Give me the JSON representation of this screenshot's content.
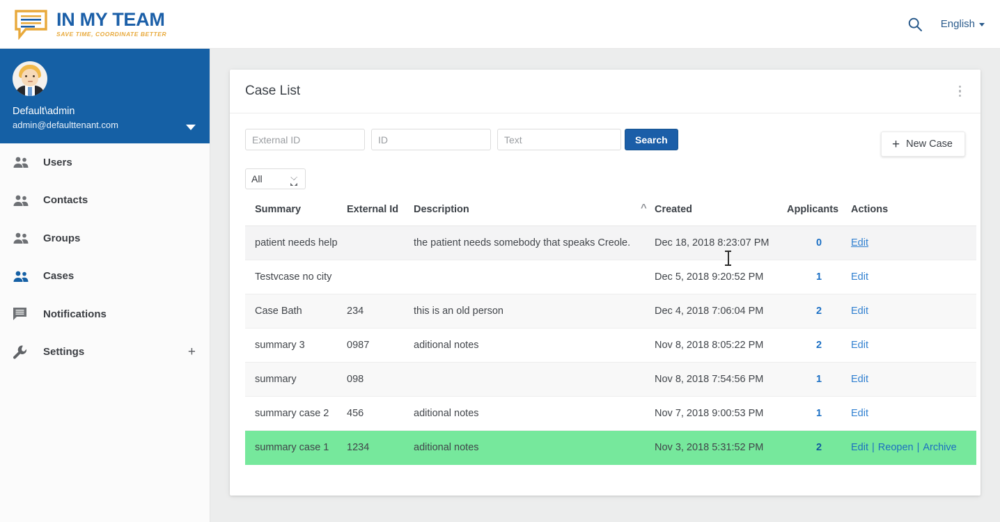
{
  "header": {
    "logo_main": "IN MY TEAM",
    "logo_sub": "SAVE TIME, COORDINATE BETTER",
    "search_icon": "search-icon",
    "language": "English"
  },
  "sidebar": {
    "user": {
      "name": "Default\\admin",
      "email": "admin@defaulttenant.com"
    },
    "items": [
      {
        "label": "Users",
        "icon": "people-icon",
        "active": false,
        "plus": false
      },
      {
        "label": "Contacts",
        "icon": "people-icon",
        "active": false,
        "plus": false
      },
      {
        "label": "Groups",
        "icon": "people-icon",
        "active": false,
        "plus": false
      },
      {
        "label": "Cases",
        "icon": "people-icon",
        "active": true,
        "plus": false
      },
      {
        "label": "Notifications",
        "icon": "chat-bubble-icon",
        "active": false,
        "plus": false
      },
      {
        "label": "Settings",
        "icon": "wrench-icon",
        "active": false,
        "plus": true,
        "plus_label": "+"
      }
    ]
  },
  "card": {
    "title": "Case List",
    "menu_icon": "kebab-menu-icon"
  },
  "filters": {
    "external_id_placeholder": "External ID",
    "external_id_value": "",
    "id_placeholder": "ID",
    "id_value": "",
    "text_placeholder": "Text",
    "text_value": "",
    "search_label": "Search",
    "new_case_label": "New Case",
    "new_case_icon": "plus-icon",
    "status_selected": "All",
    "status_options": [
      "All"
    ]
  },
  "table": {
    "columns": [
      "Summary",
      "External Id",
      "Description",
      "Created",
      "Applicants",
      "Actions"
    ],
    "sorted_column": "Created",
    "sort_direction": "asc",
    "sort_icon": "caret-up-icon",
    "rows": [
      {
        "summary": "patient needs help",
        "external_id": "",
        "description": "the patient needs somebody that speaks Creole.",
        "created": "Dec 18, 2018 8:23:07 PM",
        "applicants": "0",
        "actions": [
          "Edit"
        ],
        "state": "hovered"
      },
      {
        "summary": "Testvcase no city",
        "external_id": "",
        "description": "",
        "created": "Dec 5, 2018 9:20:52 PM",
        "applicants": "1",
        "actions": [
          "Edit"
        ],
        "state": "normal"
      },
      {
        "summary": "Case Bath",
        "external_id": "234",
        "description": "this is an old person",
        "created": "Dec 4, 2018 7:06:04 PM",
        "applicants": "2",
        "actions": [
          "Edit"
        ],
        "state": "normal"
      },
      {
        "summary": "summary 3",
        "external_id": "0987",
        "description": "aditional notes",
        "created": "Nov 8, 2018 8:05:22 PM",
        "applicants": "2",
        "actions": [
          "Edit"
        ],
        "state": "normal"
      },
      {
        "summary": "summary",
        "external_id": "098",
        "description": "",
        "created": "Nov 8, 2018 7:54:56 PM",
        "applicants": "1",
        "actions": [
          "Edit"
        ],
        "state": "normal"
      },
      {
        "summary": "summary case 2",
        "external_id": "456",
        "description": "aditional notes",
        "created": "Nov 7, 2018 9:00:53 PM",
        "applicants": "1",
        "actions": [
          "Edit"
        ],
        "state": "normal"
      },
      {
        "summary": "summary case 1",
        "external_id": "1234",
        "description": "aditional notes",
        "created": "Nov 3, 2018 5:31:52 PM",
        "applicants": "2",
        "actions": [
          "Edit",
          "Reopen",
          "Archive"
        ],
        "state": "highlighted"
      }
    ]
  },
  "colors": {
    "brand_blue": "#1b5fa8",
    "brand_gold": "#e8a93b",
    "sidebar_user_bg": "#1560a5",
    "search_button": "#1b5ea8",
    "row_highlight_green": "#76e89c",
    "link_blue": "#2f7fd0",
    "page_bg": "#eceded"
  }
}
